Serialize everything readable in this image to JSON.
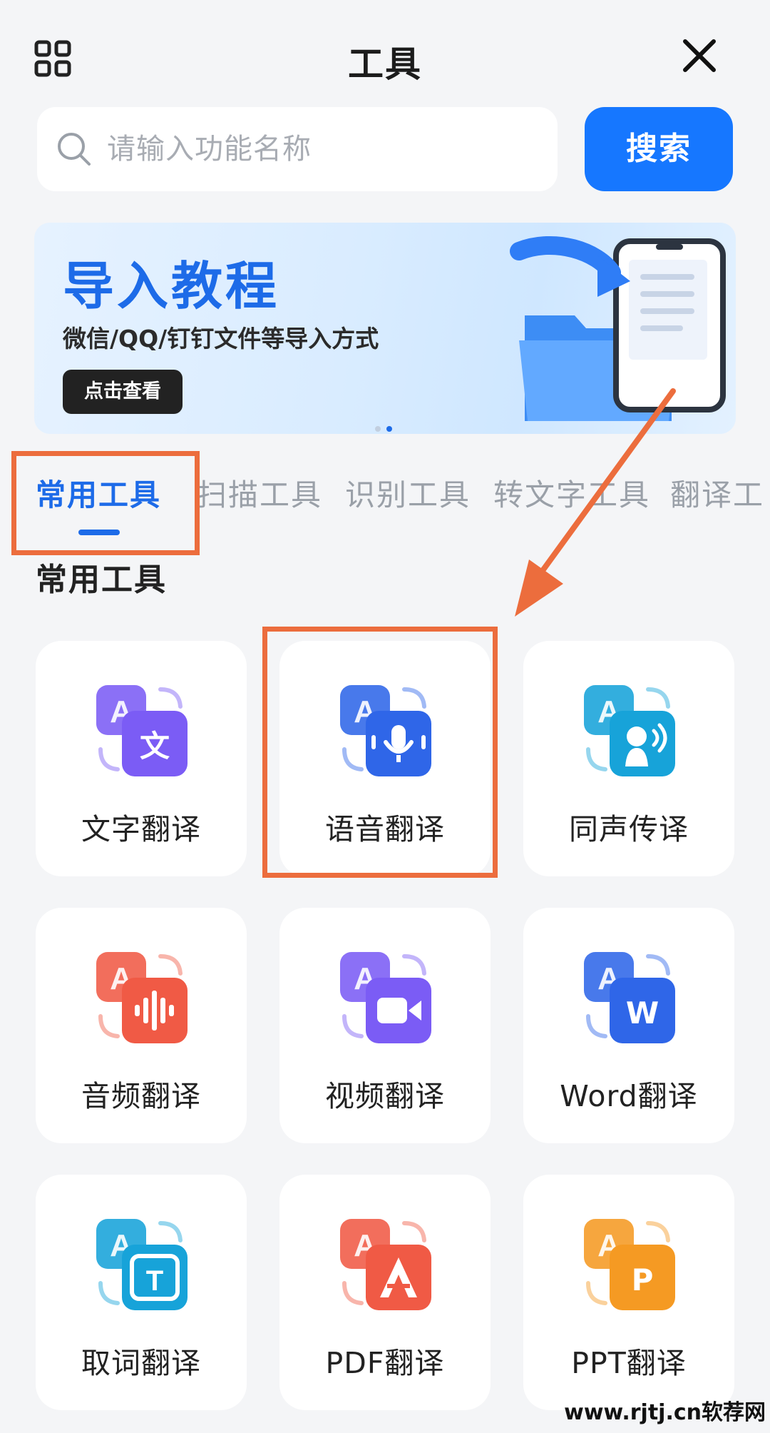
{
  "header": {
    "title": "工具",
    "left_icon": "apps-grid-icon",
    "right_icon": "close-icon"
  },
  "search": {
    "placeholder": "请输入功能名称",
    "button_label": "搜索"
  },
  "banner": {
    "title": "导入教程",
    "subtitle": "微信/QQ/钉钉文件等导入方式",
    "button_label": "点击查看"
  },
  "tabs": [
    {
      "label": "常用工具",
      "active": true
    },
    {
      "label": "扫描工具",
      "active": false
    },
    {
      "label": "识别工具",
      "active": false
    },
    {
      "label": "转文字工具",
      "active": false
    },
    {
      "label": "翻译工",
      "active": false
    }
  ],
  "section_title": "常用工具",
  "tools": [
    {
      "label": "文字翻译",
      "icon": "text-translate-icon",
      "color": "#7b5cf5",
      "glyph": "文"
    },
    {
      "label": "语音翻译",
      "icon": "voice-translate-icon",
      "color": "#2f66e8",
      "glyph": "mic"
    },
    {
      "label": "同声传译",
      "icon": "simultaneous-interpretation-icon",
      "color": "#17a3d9",
      "glyph": "speaker"
    },
    {
      "label": "音频翻译",
      "icon": "audio-translate-icon",
      "color": "#f05a45",
      "glyph": "wave"
    },
    {
      "label": "视频翻译",
      "icon": "video-translate-icon",
      "color": "#7b5cf5",
      "glyph": "video"
    },
    {
      "label": "Word翻译",
      "icon": "word-translate-icon",
      "color": "#2f66e8",
      "glyph": "W"
    },
    {
      "label": "取词翻译",
      "icon": "word-pick-translate-icon",
      "color": "#17a3d9",
      "glyph": "T"
    },
    {
      "label": "PDF翻译",
      "icon": "pdf-translate-icon",
      "color": "#f05a45",
      "glyph": "pdf"
    },
    {
      "label": "PPT翻译",
      "icon": "ppt-translate-icon",
      "color": "#f59a23",
      "glyph": "P"
    }
  ],
  "annotation_color": "#ec6d3d",
  "watermark": "www.rjtj.cn软荐网"
}
